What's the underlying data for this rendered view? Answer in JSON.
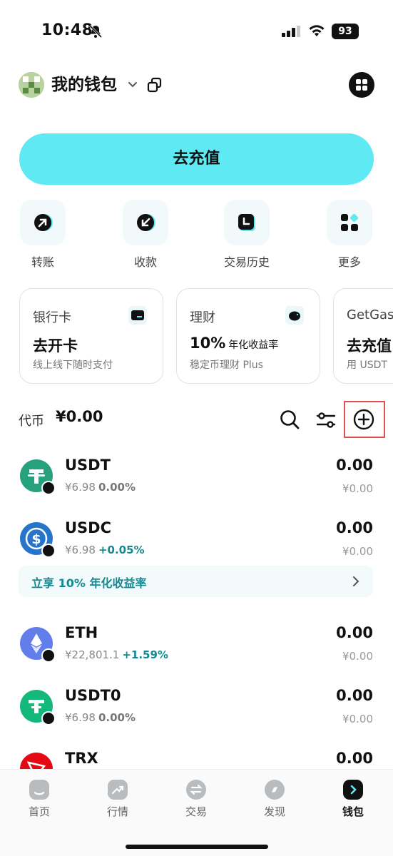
{
  "status_bar": {
    "time": "10:48",
    "battery": "93"
  },
  "header": {
    "title": "我的钱包"
  },
  "deposit": {
    "label": "去充值"
  },
  "quick_actions": [
    {
      "label": "转账",
      "icon": "send-arrow-icon"
    },
    {
      "label": "收款",
      "icon": "receive-arrow-icon"
    },
    {
      "label": "交易历史",
      "icon": "history-clock-icon"
    },
    {
      "label": "更多",
      "icon": "more-grid-icon"
    }
  ],
  "cards": [
    {
      "title": "银行卡",
      "main": "去开卡",
      "main_suffix": "",
      "sub": "线上线下随时支付",
      "icon": "card-icon"
    },
    {
      "title": "理财",
      "main": "10%",
      "main_suffix": "年化收益率",
      "sub": "稳定币理财 Plus",
      "icon": "piggy-bank-icon"
    },
    {
      "title": "GetGas",
      "main": "去充值",
      "main_suffix": "",
      "sub": "用 USDT",
      "icon": "gas-icon"
    }
  ],
  "tokens_header": {
    "label": "代币",
    "total": "¥0.00"
  },
  "tokens": [
    {
      "symbol": "USDT",
      "price": "¥6.98",
      "change": "0.00%",
      "amount": "0.00",
      "value": "¥0.00",
      "color": "#26a17b",
      "change_color": "#777777"
    },
    {
      "symbol": "USDC",
      "price": "¥6.98",
      "change": "+0.05%",
      "amount": "0.00",
      "value": "¥0.00",
      "color": "#2775ca",
      "change_color": "#138a93"
    },
    {
      "symbol": "ETH",
      "price": "¥22,801.1",
      "change": "+1.59%",
      "amount": "0.00",
      "value": "¥0.00",
      "color": "#627eea",
      "change_color": "#138a93"
    },
    {
      "symbol": "USDT0",
      "price": "¥6.98",
      "change": "0.00%",
      "amount": "0.00",
      "value": "¥0.00",
      "color": "#14b87a",
      "change_color": "#777777"
    },
    {
      "symbol": "TRX",
      "price": "",
      "change": "",
      "amount": "0.00",
      "value": "",
      "color": "#e50915",
      "change_color": "#777777"
    }
  ],
  "promo": {
    "text": "立享 10% 年化收益率"
  },
  "bottom_nav": [
    {
      "label": "首页",
      "active": false
    },
    {
      "label": "行情",
      "active": false
    },
    {
      "label": "交易",
      "active": false
    },
    {
      "label": "发现",
      "active": false
    },
    {
      "label": "钱包",
      "active": true
    }
  ]
}
